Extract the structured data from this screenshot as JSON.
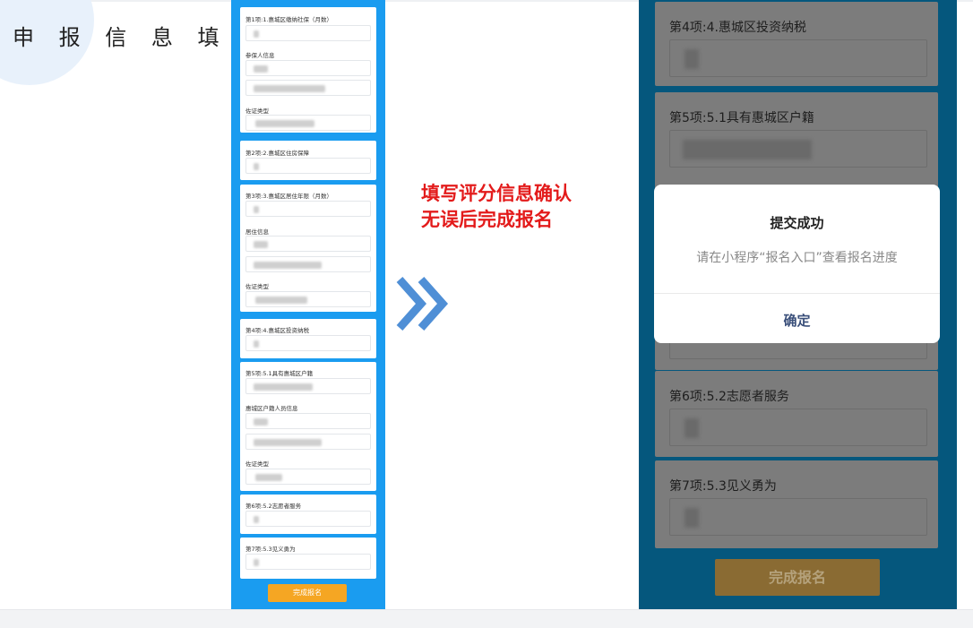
{
  "page_title": "申 报 信 息 填 写",
  "left_phone": {
    "cards": [
      {
        "labels": [
          "第1项:1.惠城区缴纳社保（月数）",
          "参保人信息",
          "佐证类型"
        ]
      },
      {
        "labels": [
          "第2项:2.惠城区住房保障"
        ]
      },
      {
        "labels": [
          "第3项:3.惠城区居住年限（月数）",
          "居住信息",
          "佐证类型"
        ]
      },
      {
        "labels": [
          "第4项:4.惠城区投资纳税"
        ]
      },
      {
        "labels": [
          "第5项:5.1具有惠城区户籍",
          "惠城区户籍人员信息",
          "佐证类型"
        ]
      },
      {
        "labels": [
          "第6项:5.2志愿者服务"
        ]
      },
      {
        "labels": [
          "第7项:5.3见义勇为"
        ]
      }
    ],
    "submit_label": "完成报名"
  },
  "note": {
    "line1": "填写评分信息确认",
    "line2": "无误后完成报名"
  },
  "right_phone": {
    "cards": [
      {
        "label": "第4项:4.惠城区投资纳税"
      },
      {
        "label": "第5项:5.1具有惠城区户籍"
      },
      {
        "label": "第6项:5.2志愿者服务"
      },
      {
        "label": "第7项:5.3见义勇为"
      }
    ],
    "submit_label": "完成报名"
  },
  "dialog": {
    "title": "提交成功",
    "message": "请在小程序“报名入口”查看报名进度",
    "confirm_label": "确定"
  },
  "icons": {
    "arrow": "double-chevron-right-icon"
  },
  "colors": {
    "phone_blue": "#1a9cf0",
    "accent_red": "#e31b1b",
    "button_orange": "#f5a623",
    "overlay_bg": "#05577d"
  }
}
